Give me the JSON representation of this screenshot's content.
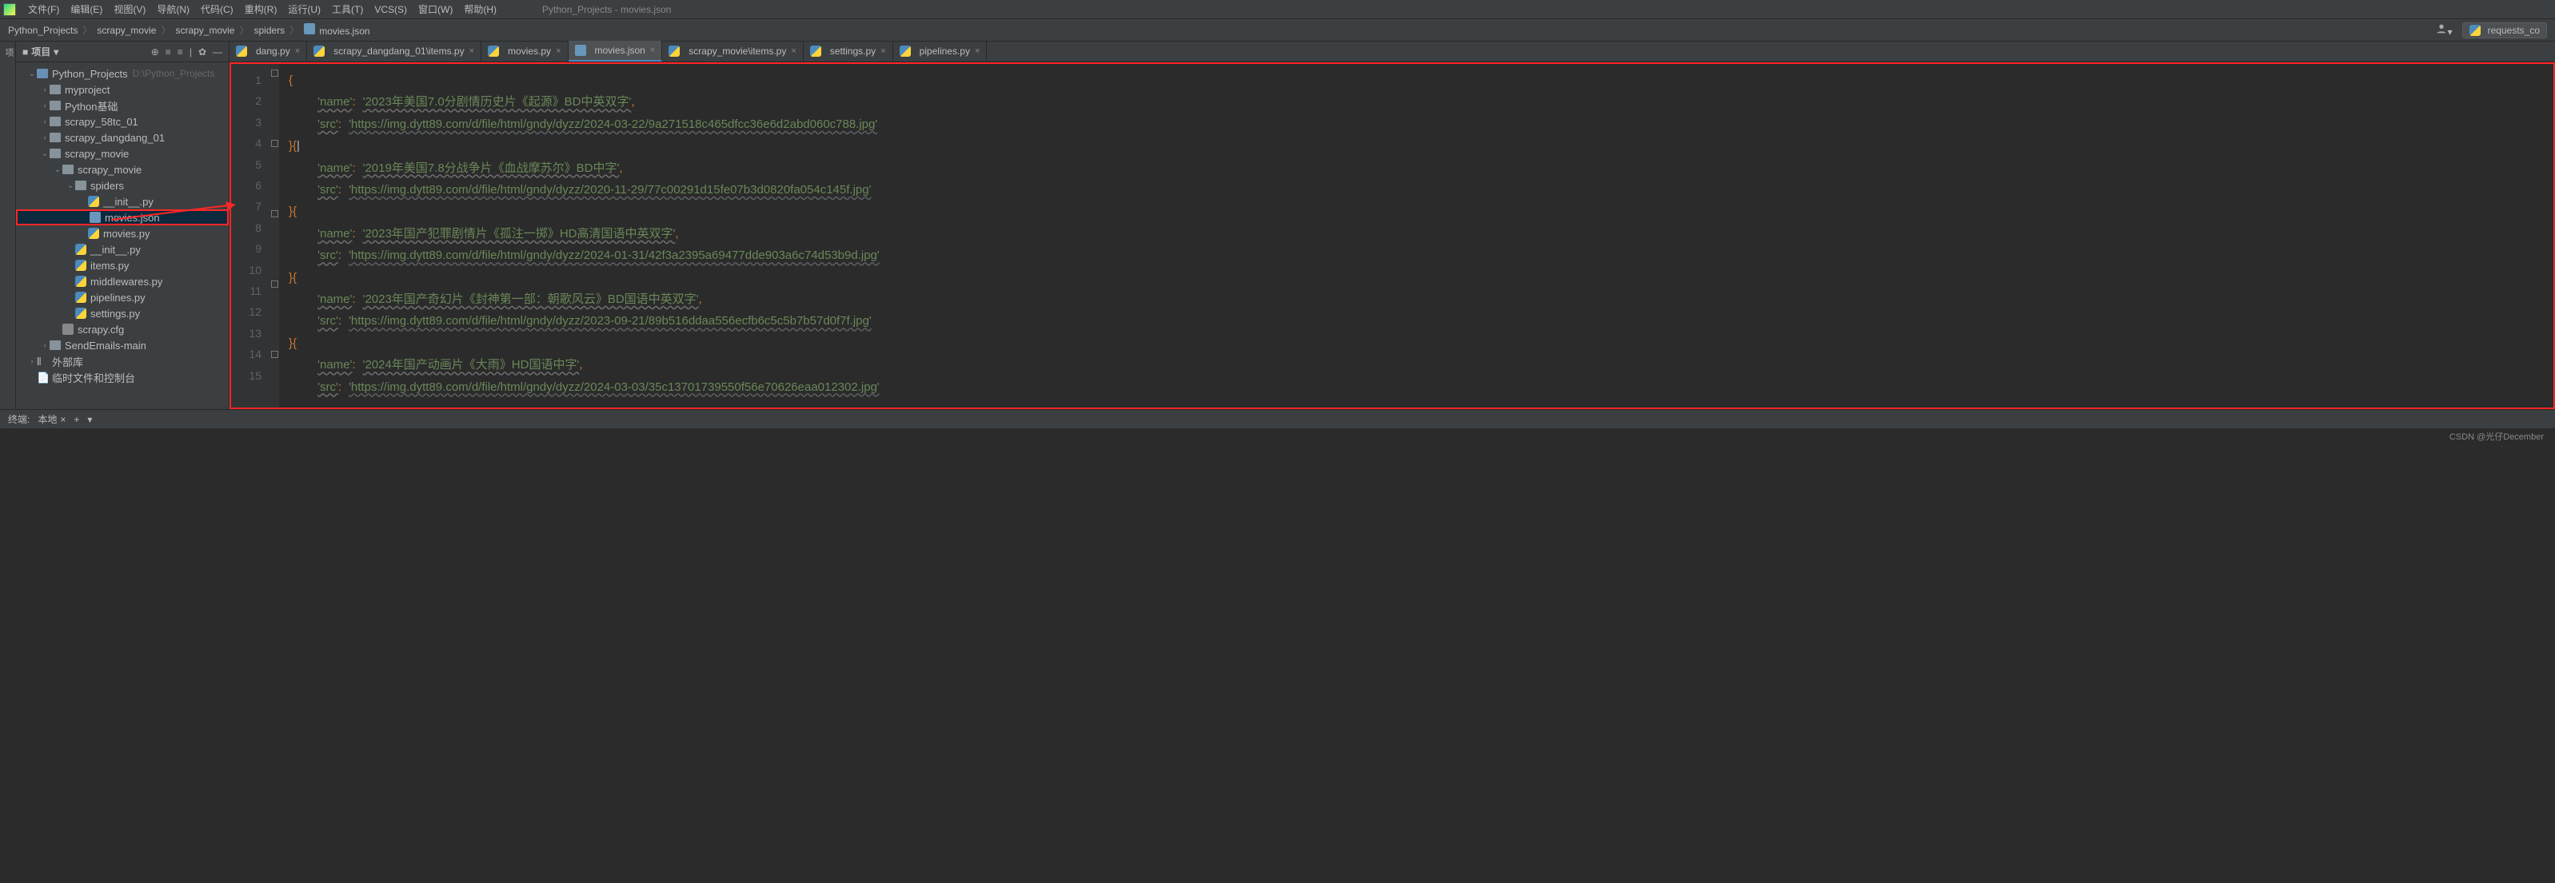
{
  "window_title": "Python_Projects - movies.json",
  "menu": [
    "文件(F)",
    "编辑(E)",
    "视图(V)",
    "导航(N)",
    "代码(C)",
    "重构(R)",
    "运行(U)",
    "工具(T)",
    "VCS(S)",
    "窗口(W)",
    "帮助(H)"
  ],
  "breadcrumbs": [
    "Python_Projects",
    "scrapy_movie",
    "scrapy_movie",
    "spiders",
    "movies.json"
  ],
  "run_config": "requests_co",
  "panel": {
    "title": "项目",
    "left_strip": "项"
  },
  "tree": [
    {
      "d": 0,
      "a": "open",
      "t": "folder-root",
      "label": "Python_Projects",
      "hint": "D:\\Python_Projects"
    },
    {
      "d": 1,
      "a": "closed",
      "t": "folder",
      "label": "myproject"
    },
    {
      "d": 1,
      "a": "closed",
      "t": "folder",
      "label": "Python基础"
    },
    {
      "d": 1,
      "a": "closed",
      "t": "folder",
      "label": "scrapy_58tc_01"
    },
    {
      "d": 1,
      "a": "closed",
      "t": "folder",
      "label": "scrapy_dangdang_01"
    },
    {
      "d": 1,
      "a": "open",
      "t": "folder",
      "label": "scrapy_movie"
    },
    {
      "d": 2,
      "a": "open",
      "t": "folder",
      "label": "scrapy_movie"
    },
    {
      "d": 3,
      "a": "open",
      "t": "folder",
      "label": "spiders"
    },
    {
      "d": 4,
      "a": "none",
      "t": "py",
      "label": "__init__.py"
    },
    {
      "d": 4,
      "a": "none",
      "t": "json",
      "label": "movies.json",
      "sel": true,
      "box": true
    },
    {
      "d": 4,
      "a": "none",
      "t": "py",
      "label": "movies.py"
    },
    {
      "d": 3,
      "a": "none",
      "t": "py",
      "label": "__init__.py"
    },
    {
      "d": 3,
      "a": "none",
      "t": "py",
      "label": "items.py"
    },
    {
      "d": 3,
      "a": "none",
      "t": "py",
      "label": "middlewares.py"
    },
    {
      "d": 3,
      "a": "none",
      "t": "py",
      "label": "pipelines.py"
    },
    {
      "d": 3,
      "a": "none",
      "t": "py",
      "label": "settings.py"
    },
    {
      "d": 2,
      "a": "none",
      "t": "cfg",
      "label": "scrapy.cfg"
    },
    {
      "d": 1,
      "a": "closed",
      "t": "folder",
      "label": "SendEmails-main"
    },
    {
      "d": 0,
      "a": "closed",
      "t": "lib",
      "label": "外部库"
    },
    {
      "d": 0,
      "a": "none",
      "t": "scratch",
      "label": "临时文件和控制台"
    }
  ],
  "tabs": [
    {
      "label": "dang.py",
      "icon": "py"
    },
    {
      "label": "scrapy_dangdang_01\\items.py",
      "icon": "py"
    },
    {
      "label": "movies.py",
      "icon": "py"
    },
    {
      "label": "movies.json",
      "icon": "json",
      "active": true
    },
    {
      "label": "scrapy_movie\\items.py",
      "icon": "py"
    },
    {
      "label": "settings.py",
      "icon": "py"
    },
    {
      "label": "pipelines.py",
      "icon": "py"
    }
  ],
  "gutter": [
    "1",
    "2",
    "3",
    "4",
    "5",
    "6",
    "7",
    "8",
    "9",
    "10",
    "11",
    "12",
    "13",
    "14",
    "15"
  ],
  "code": {
    "entries": [
      {
        "name": "'2023年美国7.0分剧情历史片《起源》BD中英双字'",
        "src": "'https://img.dytt89.com/d/file/html/gndy/dyzz/2024-03-22/9a271518c465dfcc36e6d2abd060c788.jpg'"
      },
      {
        "name": "'2019年美国7.8分战争片《血战摩苏尔》BD中字'",
        "src": "'https://img.dytt89.com/d/file/html/gndy/dyzz/2020-11-29/77c00291d15fe07b3d0820fa054c145f.jpg'"
      },
      {
        "name": "'2023年国产犯罪剧情片《孤注一掷》HD高清国语中英双字'",
        "src": "'https://img.dytt89.com/d/file/html/gndy/dyzz/2024-01-31/42f3a2395a69477dde903a6c74d53b9d.jpg'"
      },
      {
        "name": "'2023年国产奇幻片《封神第一部：朝歌风云》BD国语中英双字'",
        "src": "'https://img.dytt89.com/d/file/html/gndy/dyzz/2023-09-21/89b516ddaa556ecfb6c5c5b7b57d0f7f.jpg'"
      },
      {
        "name": "'2024年国产动画片《大雨》HD国语中字'",
        "src": "'https://img.dytt89.com/d/file/html/gndy/dyzz/2024-03-03/35c13701739550f56e70626eaa012302.jpg'"
      }
    ]
  },
  "terminal": {
    "label": "终端:",
    "tab": "本地"
  },
  "watermark": "CSDN @光仔December",
  "chart_data": null
}
